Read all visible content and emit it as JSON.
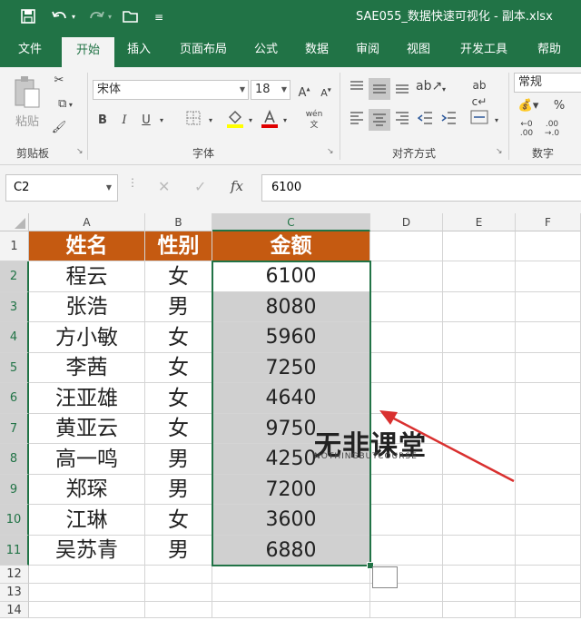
{
  "title": "SAE055_数据快速可视化 - 副本.xlsx",
  "tabs": [
    "文件",
    "开始",
    "插入",
    "页面布局",
    "公式",
    "数据",
    "审阅",
    "视图",
    "开发工具",
    "帮助"
  ],
  "active_tab": "开始",
  "ribbon": {
    "clipboard": {
      "paste_label": "粘贴",
      "group_label": "剪贴板"
    },
    "font": {
      "font_name": "宋体",
      "font_size": "18",
      "bold": "B",
      "italic": "I",
      "underline": "U",
      "phonetic": "wén",
      "group_label": "字体"
    },
    "alignment": {
      "group_label": "对齐方式"
    },
    "number": {
      "format": "常规",
      "percent": "%",
      "group_label": "数字"
    }
  },
  "formula_bar": {
    "name_box": "C2",
    "fx": "fx",
    "value": "6100"
  },
  "columns": [
    "A",
    "B",
    "C",
    "D",
    "E",
    "F"
  ],
  "rows": [
    "1",
    "2",
    "3",
    "4",
    "5",
    "6",
    "7",
    "8",
    "9",
    "10",
    "11",
    "12",
    "13",
    "14"
  ],
  "table": {
    "headers": [
      "姓名",
      "性别",
      "金额"
    ],
    "data": [
      [
        "程云",
        "女",
        "6100"
      ],
      [
        "张浩",
        "男",
        "8080"
      ],
      [
        "方小敏",
        "女",
        "5960"
      ],
      [
        "李茜",
        "女",
        "7250"
      ],
      [
        "汪亚雄",
        "女",
        "4640"
      ],
      [
        "黄亚云",
        "女",
        "9750"
      ],
      [
        "高一鸣",
        "男",
        "4250"
      ],
      [
        "郑琛",
        "男",
        "7200"
      ],
      [
        "江琳",
        "女",
        "3600"
      ],
      [
        "吴苏青",
        "男",
        "6880"
      ]
    ]
  },
  "selection": "C2:C11",
  "watermark": {
    "main": "无非课堂",
    "sub": "NOTHINGBUTCOURSE"
  },
  "colors": {
    "excel_green": "#217346",
    "header_fill": "#c55a11",
    "highlight": "#d0d0d0",
    "arrow": "#d9302f"
  }
}
